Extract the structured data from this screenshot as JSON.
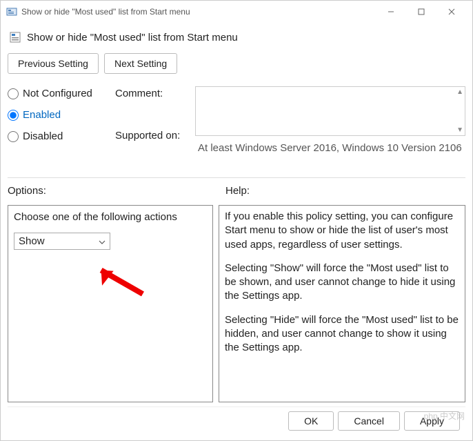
{
  "titlebar": {
    "title": "Show or hide \"Most used\" list from Start menu"
  },
  "header": {
    "title": "Show or hide \"Most used\" list from Start menu"
  },
  "nav": {
    "prev": "Previous Setting",
    "next": "Next Setting"
  },
  "radios": {
    "not_configured": "Not Configured",
    "enabled": "Enabled",
    "disabled": "Disabled"
  },
  "labels": {
    "comment": "Comment:",
    "supported": "Supported on:",
    "options": "Options:",
    "help": "Help:"
  },
  "supported_text": "At least Windows Server 2016, Windows 10 Version 2106",
  "options": {
    "prompt": "Choose one of the following actions",
    "selected": "Show"
  },
  "help": {
    "p1": "If you enable this policy setting, you can configure Start menu to show or hide the list of user's most used apps, regardless of user settings.",
    "p2": "Selecting \"Show\" will force the \"Most used\" list to be shown, and user cannot change to hide it using the Settings app.",
    "p3": "Selecting \"Hide\" will force the \"Most used\" list to be hidden, and user cannot change to show it using the Settings app."
  },
  "footer": {
    "ok": "OK",
    "cancel": "Cancel",
    "apply": "Apply"
  },
  "watermark": "php 中文网"
}
